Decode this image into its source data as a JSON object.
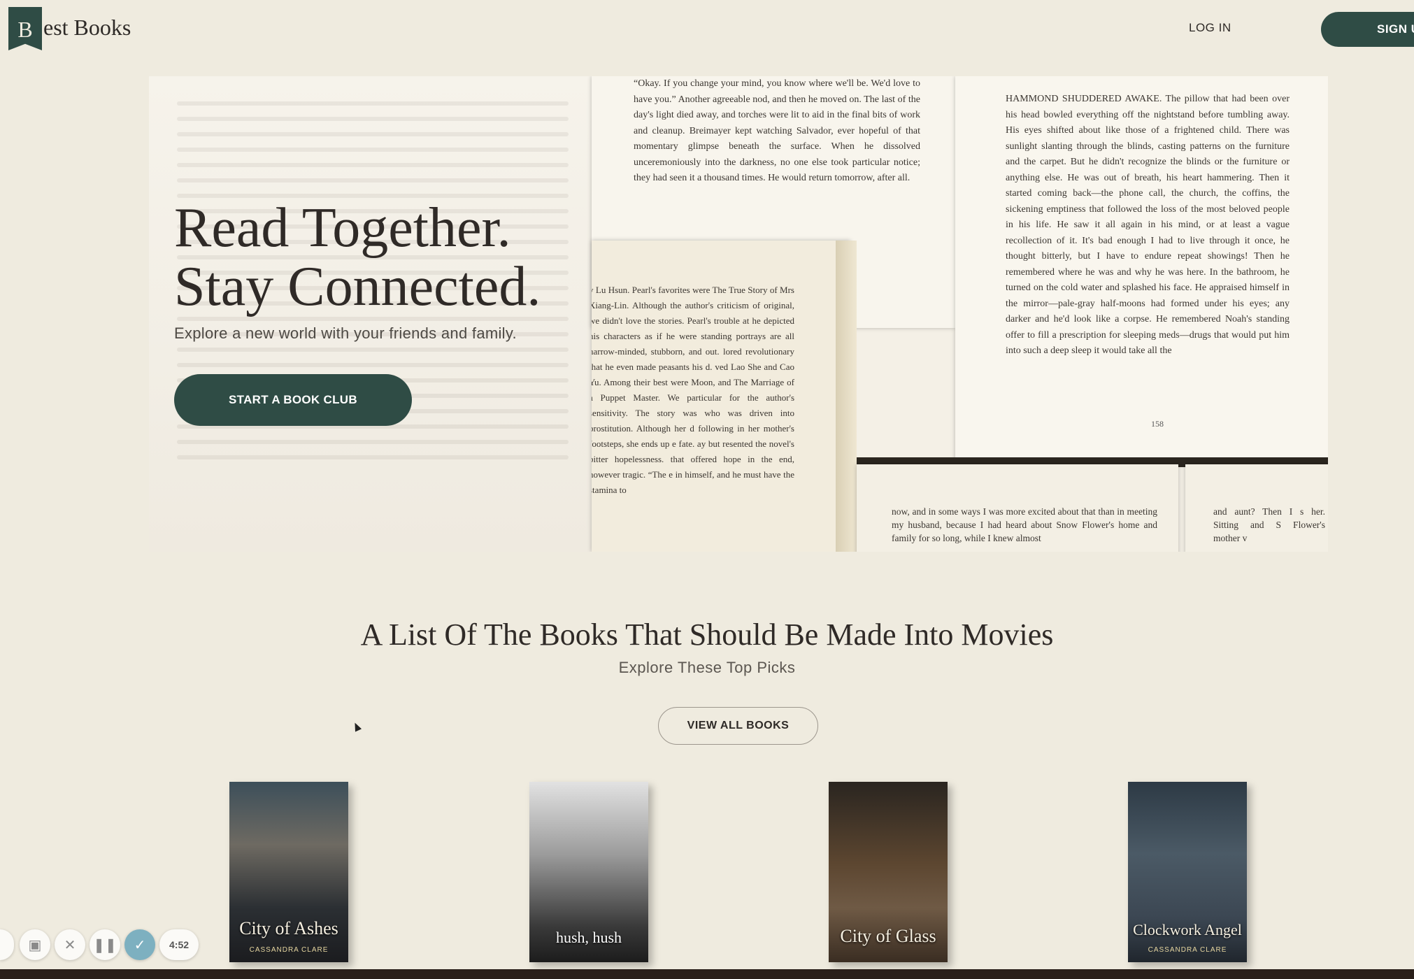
{
  "header": {
    "logo_mark": "B",
    "logo_text": "est Books",
    "login_label": "LOG IN",
    "signup_label": "SIGN U"
  },
  "hero": {
    "title_line1": "Read Together.",
    "title_line2": "Stay Connected.",
    "subtitle": "Explore a new world with your friends and family.",
    "cta_label": "START A BOOK CLUB",
    "page_left_text": "“Okay. If you change your mind, you know where we'll be. We'd love to have you.” Another agreeable nod, and then he moved on. The last of the day's light died away, and torches were lit to aid in the final bits of work and cleanup. Breimayer kept watching Salvador, ever hopeful of that momentary glimpse beneath the surface. When he dissolved unceremoniously into the darkness, no one else took particular notice; they had seen it a thousand times. He would return tomorrow, after all.",
    "page_right_text": "HAMMOND SHUDDERED AWAKE. The pillow that had been over his head bowled everything off the nightstand before tumbling away. His eyes shifted about like those of a frightened child. There was sunlight slanting through the blinds, casting patterns on the furniture and the carpet. But he didn't recognize the blinds or the furniture or anything else. He was out of breath, his heart hammering. Then it started coming back—the phone call, the church, the coffins, the sickening emptiness that followed the loss of the most beloved people in his life. He saw it all again in his mind, or at least a vague recollection of it. It's bad enough I had to live through it once, he thought bitterly, but I have to endure repeat showings! Then he remembered where he was and why he was here. In the bathroom, he turned on the cold water and splashed his face. He appraised himself in the mirror—pale-gray half-moons had formed under his eyes; any darker and he'd look like a corpse. He remembered Noah's standing offer to fill a prescription for sleeping meds—drugs that would put him into such a deep sleep it would take all the",
    "page_right_num": "158",
    "page_middle_text": "y Lu Hsun. Pearl's favorites were The True Story of Mrs Xiang-Lin. Although the author's criticism of original, we didn't love the stories. Pearl's trouble at he depicted his characters as if he were standing portrays are all narrow-minded, stubborn, and out. lored revolutionary that he even made peasants his d. ved Lao She and Cao Yu. Among their best were Moon, and The Marriage of a Puppet Master. We particular for the author's sensitivity. The story was who was driven into prostitution. Although her d following in her mother's footsteps, she ends up e fate. ay but resented the novel's bitter hopelessness. that offered hope in the end, however tragic. “The e in himself, and he must have the stamina to",
    "page_bottom_text": "now, and in some ways I was more excited about that than in meeting my husband, because I had heard about Snow Flower's home and family for so long, while I knew almost",
    "page_bottom_right_text": "and aunt? Then I s her. Sitting and S Flower's mother v"
  },
  "list_section": {
    "title": "A List Of The Books That Should Be Made Into Movies",
    "subtitle": "Explore These Top Picks",
    "view_all_label": "VIEW ALL BOOKS",
    "books": [
      {
        "title": "City of Ashes",
        "author": "CASSANDRA CLARE"
      },
      {
        "title": "hush, hush",
        "author": ""
      },
      {
        "title": "City of Glass",
        "author": ""
      },
      {
        "title": "Clockwork Angel",
        "author": "CASSANDRA CLARE"
      }
    ]
  },
  "recorder": {
    "time": "4:52",
    "icons": [
      "camera-icon",
      "close-icon",
      "pause-icon",
      "check-icon"
    ]
  },
  "colors": {
    "background": "#efebdf",
    "brand_green": "#2f4c45",
    "text_dark": "#2e2a27"
  }
}
